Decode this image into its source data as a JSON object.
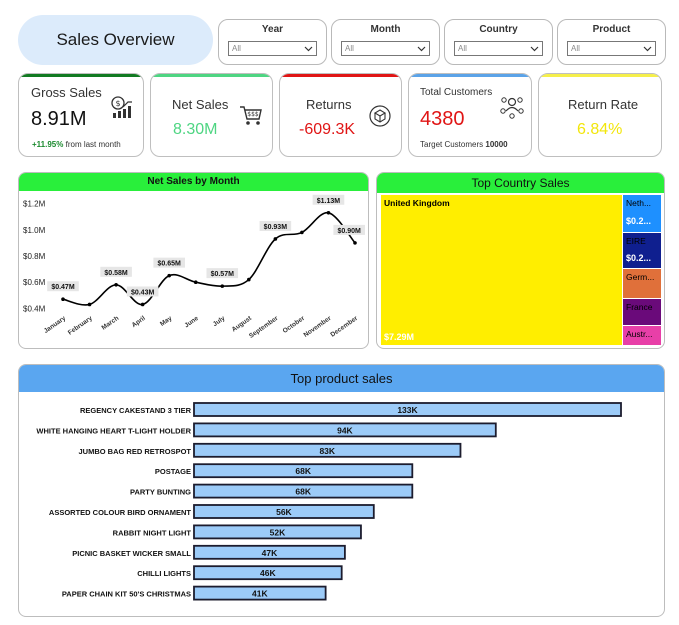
{
  "title": "Sales Overview",
  "filters": [
    {
      "label": "Year",
      "value": "All"
    },
    {
      "label": "Month",
      "value": "All"
    },
    {
      "label": "Country",
      "value": "All"
    },
    {
      "label": "Product",
      "value": "All"
    }
  ],
  "kpis": {
    "gross_sales": {
      "title": "Gross Sales",
      "value": "8.91M",
      "change": "+11.95%",
      "change_note": "from last month",
      "color": "#1a8a2e",
      "icon": "money-chart-icon"
    },
    "net_sales": {
      "title": "Net Sales",
      "value": "8.30M",
      "color": "#4ed582",
      "icon": "shopping-cart-icon"
    },
    "returns": {
      "title": "Returns",
      "value": "-609.3K",
      "color": "#e01515",
      "icon": "return-box-icon"
    },
    "total_customers": {
      "title": "Total Customers",
      "value": "4380",
      "target_label": "Target Customers",
      "target_value": "10000",
      "color": "#e01515",
      "bar_color": "#5ba3e8",
      "icon": "customers-icon"
    },
    "return_rate": {
      "title": "Return Rate",
      "value": "6.84%",
      "color": "#f2e60b",
      "bar_color": "#f5ef4a"
    }
  },
  "colors": {
    "panel_header_green": "#29ef3b",
    "panel_header_blue": "#5aa6f0",
    "bar_fill": "#9ccbf8",
    "bar_border": "#1c1c2e",
    "line": "#000000"
  },
  "chart_data": [
    {
      "type": "line",
      "title": "Net Sales by Month",
      "x": [
        "January",
        "February",
        "March",
        "April",
        "May",
        "June",
        "July",
        "August",
        "September",
        "October",
        "November",
        "December"
      ],
      "series": [
        {
          "values": [
            0.47,
            0.43,
            0.58,
            0.43,
            0.65,
            0.6,
            0.57,
            0.62,
            0.93,
            0.98,
            1.13,
            0.9
          ]
        }
      ],
      "data_labels": [
        {
          "month": "January",
          "label": "$0.47M"
        },
        {
          "month": "March",
          "label": "$0.58M"
        },
        {
          "month": "April",
          "label": "$0.43M"
        },
        {
          "month": "May",
          "label": "$0.65M"
        },
        {
          "month": "July",
          "label": "$0.57M"
        },
        {
          "month": "September",
          "label": "$0.93M"
        },
        {
          "month": "November",
          "label": "$1.13M"
        },
        {
          "month": "December",
          "label": "$0.90M"
        }
      ],
      "yticks": [
        "$0.4M",
        "$0.6M",
        "$0.8M",
        "$1.0M",
        "$1.2M"
      ],
      "ylim": [
        0.38,
        1.22
      ],
      "grid": false
    },
    {
      "type": "treemap",
      "title": "Top Country Sales",
      "items": [
        {
          "name": "United Kingdom",
          "label": "$7.29M",
          "value": 7.29,
          "color": "#ffee00"
        },
        {
          "name": "Neth...",
          "label": "$0.2...",
          "value": 0.28,
          "color": "#1e90ff"
        },
        {
          "name": "EIRE",
          "label": "$0.2...",
          "value": 0.26,
          "color": "#0f1f8f"
        },
        {
          "name": "Germ...",
          "value": 0.22,
          "color": "#e0703a"
        },
        {
          "name": "France",
          "value": 0.2,
          "color": "#6a0a7a"
        },
        {
          "name": "Austr...",
          "value": 0.14,
          "color": "#e83fa8"
        }
      ]
    },
    {
      "type": "bar",
      "orientation": "horizontal",
      "title": "Top product sales",
      "categories": [
        "REGENCY CAKESTAND 3 TIER",
        "WHITE HANGING HEART T-LIGHT HOLDER",
        "JUMBO BAG RED RETROSPOT",
        "POSTAGE",
        "PARTY BUNTING",
        "ASSORTED COLOUR BIRD ORNAMENT",
        "RABBIT NIGHT LIGHT",
        "PICNIC BASKET WICKER SMALL",
        "CHILLI LIGHTS",
        "PAPER CHAIN KIT 50'S CHRISTMAS"
      ],
      "values": [
        133,
        94,
        83,
        68,
        68,
        56,
        52,
        47,
        46,
        41
      ],
      "labels": [
        "133K",
        "94K",
        "83K",
        "68K",
        "68K",
        "56K",
        "52K",
        "47K",
        "46K",
        "41K"
      ],
      "unit": "K"
    }
  ]
}
